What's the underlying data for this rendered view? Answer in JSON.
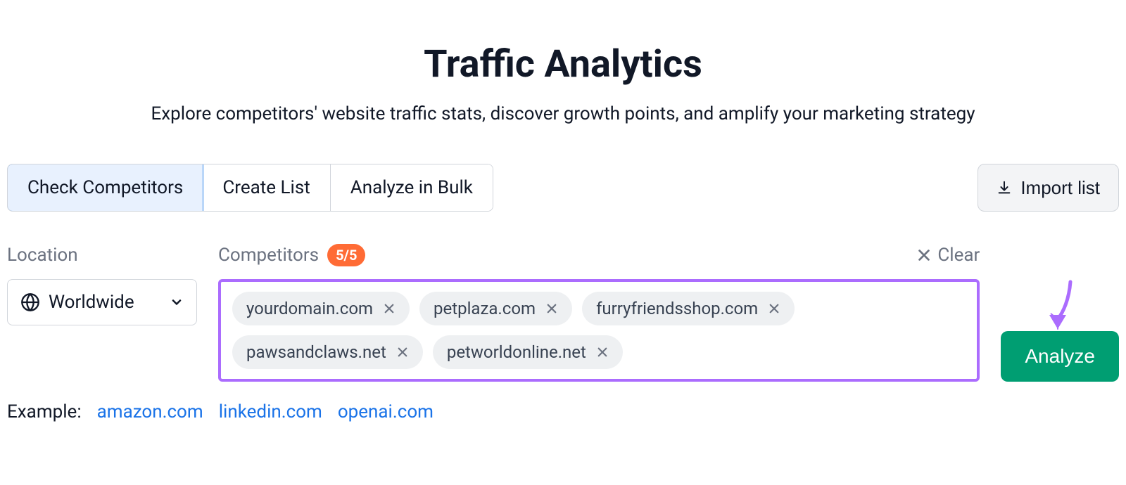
{
  "header": {
    "title": "Traffic Analytics",
    "subtitle": "Explore competitors' website traffic stats, discover growth points, and amplify your marketing strategy"
  },
  "tabs": {
    "check_competitors": "Check Competitors",
    "create_list": "Create List",
    "analyze_bulk": "Analyze in Bulk"
  },
  "import_button": "Import list",
  "location": {
    "label": "Location",
    "value": "Worldwide"
  },
  "competitors": {
    "label": "Competitors",
    "badge": "5/5",
    "clear": "Clear",
    "chips": [
      "yourdomain.com",
      "petplaza.com",
      "furryfriendsshop.com",
      "pawsandclaws.net",
      "petworldonline.net"
    ]
  },
  "analyze_button": "Analyze",
  "examples": {
    "label": "Example:",
    "links": [
      "amazon.com",
      "linkedin.com",
      "openai.com"
    ]
  }
}
